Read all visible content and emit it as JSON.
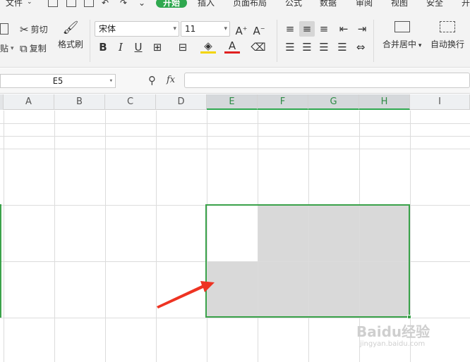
{
  "menu": {
    "file": "文件",
    "items": [
      "开始",
      "插入",
      "页面布局",
      "公式",
      "数据",
      "审阅",
      "视图",
      "安全",
      "开"
    ],
    "active_index": 0
  },
  "clipboard": {
    "cut": "剪切",
    "paste_fragment": "贴",
    "copy": "复制",
    "format_painter": "格式刷"
  },
  "font": {
    "family": "宋体",
    "size": "11"
  },
  "alignment": {
    "merge_center": "合并居中",
    "wrap_text": "自动换行"
  },
  "namebox": {
    "value": "E5"
  },
  "formula": {
    "fx_label": "fx",
    "value": ""
  },
  "sheet": {
    "columns": [
      "A",
      "B",
      "C",
      "D",
      "E",
      "F",
      "G",
      "H",
      "I"
    ],
    "selected_columns": [
      "E",
      "F",
      "G",
      "H"
    ],
    "selection": "E5:H6",
    "colors": {
      "accent": "#2fa84f",
      "selection_border": "#3aa24a",
      "selected_fill": "#d9d9d9",
      "arrow": "#ee3322"
    }
  },
  "watermark": {
    "logo": "Baidu经验",
    "url": "jingyan.baidu.com"
  }
}
